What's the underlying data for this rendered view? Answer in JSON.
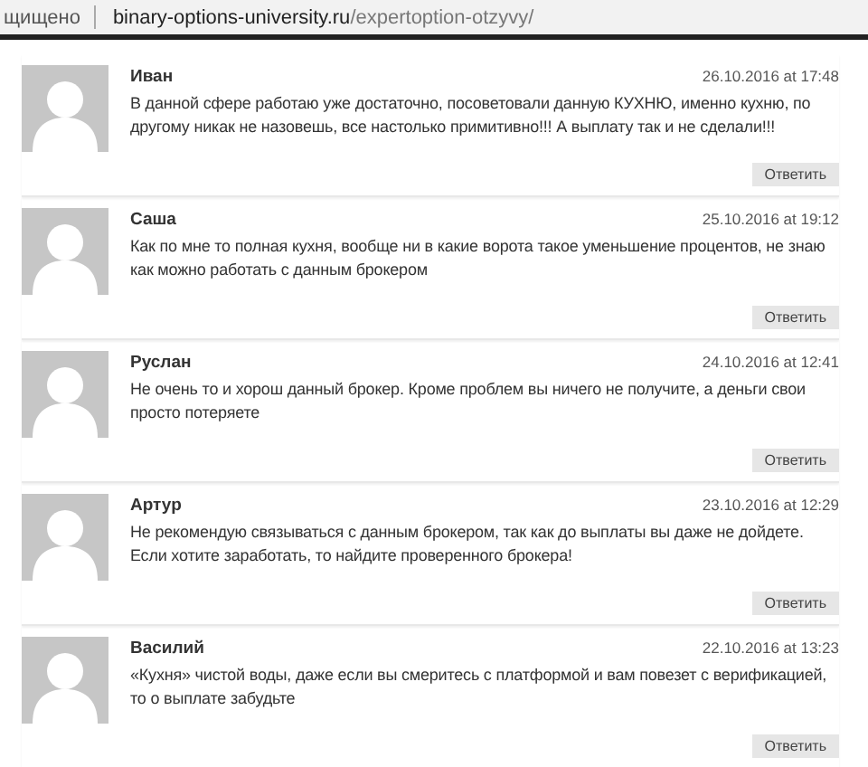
{
  "address_bar": {
    "security_label": "щищено",
    "url_domain": "binary-options-university.ru",
    "url_path": "/expertoption-otzyvy/"
  },
  "comments": [
    {
      "author": "Иван",
      "date": "26.10.2016 at 17:48",
      "text": "В данной сфере работаю уже достаточно, посоветовали данную КУХНЮ, именно кухню, по другому никак не назовешь, все настолько примитивно!!! А выплату так и не сделали!!!",
      "reply": "Ответить"
    },
    {
      "author": "Саша",
      "date": "25.10.2016 at 19:12",
      "text": "Как по мне то полная кухня, вообще ни в какие ворота такое уменьшение процентов, не знаю как можно работать с данным брокером",
      "reply": "Ответить"
    },
    {
      "author": "Руслан",
      "date": "24.10.2016 at 12:41",
      "text": "Не очень то и хорош данный брокер. Кроме проблем вы ничего не получите, а деньги свои просто потеряете",
      "reply": "Ответить"
    },
    {
      "author": "Артур",
      "date": "23.10.2016 at 12:29",
      "text": "Не рекомендую связываться с данным брокером, так как до выплаты вы даже не дойдете. Если хотите заработать, то найдите проверенного брокера!",
      "reply": "Ответить"
    },
    {
      "author": "Василий",
      "date": "22.10.2016 at 13:23",
      "text": "«Кухня» чистой воды, даже если вы смеритесь с платформой и вам повезет с верификацией, то о выплате забудьте",
      "reply": "Ответить"
    }
  ]
}
